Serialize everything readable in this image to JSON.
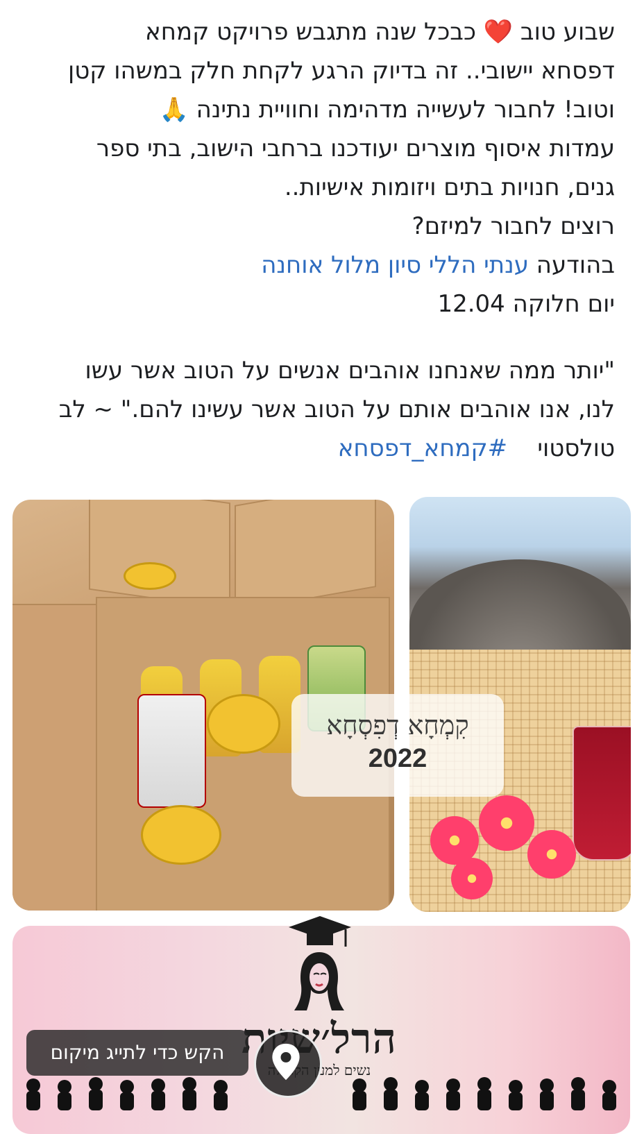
{
  "post": {
    "line1_a": "שבוע טוב",
    "line1_b": "כבכל שנה מתגבש פרויקט קמחא",
    "line2": "דפסחא יישובי.. זה בדיוק הרגע לקחת חלק במשהו קטן",
    "line3": "וטוב! לחבור לעשייה מדהימה וחוויית נתינה 🙏",
    "line4": "עמדות איסוף מוצרים יעודכנו ברחבי הישוב, בתי ספר",
    "line5": "גנים, חנויות בתים ויזומות אישיות..",
    "line6": "רוצים לחבור למיזם?",
    "line7_prefix": "בהודעה",
    "line7_link": "ענתי הללי סיון מלול אוחנה",
    "line8": "יום חלוקה 12.04",
    "quote1": "\"יותר ממה שאנחנו אוהבים אנשים על הטוב אשר עשו",
    "quote2": "לנו, אנו אוהבים אותם על הטוב אשר עשינו להם.\" ~ לב",
    "quote3_prefix": "טולסטוי",
    "hashtag": "#קמחא_דפסחא"
  },
  "media": {
    "caption_title": "קִמְחָא דְפִסְחָא",
    "caption_year": "2022",
    "logo_name": "הרל׳שיות",
    "logo_tagline": "נשים למען הקהילה",
    "tag_location_label": "הקש כדי לתייג מיקום"
  },
  "icons": {
    "heart": "heart-icon",
    "location": "map-pin-icon",
    "play": "media-indicator-icon"
  },
  "colors": {
    "link": "#2e6cbf",
    "heart": "#e0182c"
  }
}
